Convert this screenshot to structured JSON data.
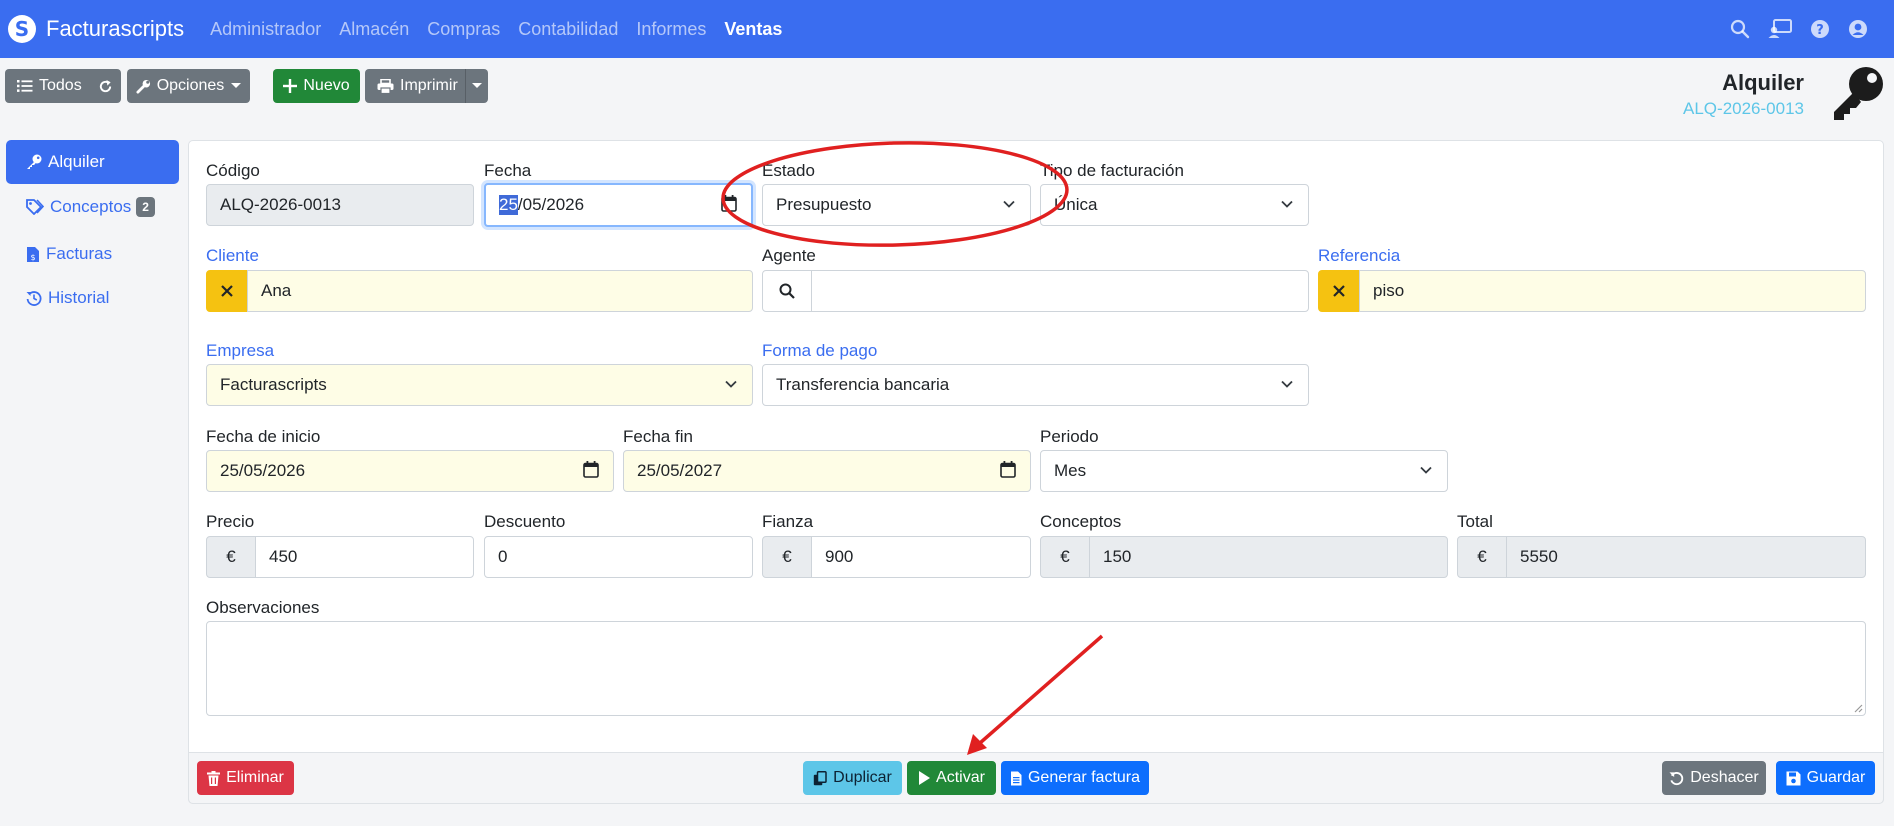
{
  "navbar": {
    "brand": "Facturascripts",
    "brand_glyph": "S",
    "menu": [
      "Administrador",
      "Almacén",
      "Compras",
      "Contabilidad",
      "Informes",
      "Ventas"
    ],
    "active_menu": "Ventas",
    "icons": [
      "search-icon",
      "notifications-icon",
      "help-icon",
      "user-icon"
    ]
  },
  "toolbar": {
    "all_label": "Todos",
    "options_label": "Opciones",
    "new_label": "Nuevo",
    "print_label": "Imprimir"
  },
  "header": {
    "title": "Alquiler",
    "code": "ALQ-2026-0013",
    "icon": "key-icon"
  },
  "sidebar": {
    "items": [
      {
        "label": "Alquiler",
        "icon": "key-icon",
        "active": true
      },
      {
        "label": "Conceptos",
        "icon": "tags-icon",
        "badge": "2"
      },
      {
        "label": "Facturas",
        "icon": "invoice-icon"
      },
      {
        "label": "Historial",
        "icon": "history-icon"
      }
    ]
  },
  "form": {
    "codigo_label": "Código",
    "codigo_value": "ALQ-2026-0013",
    "fecha_label": "Fecha",
    "fecha_day": "25",
    "fecha_rest": "/05/2026",
    "estado_label": "Estado",
    "estado_value": "Presupuesto",
    "tipo_label": "Tipo de facturación",
    "tipo_value": "Única",
    "cliente_label": "Cliente",
    "cliente_value": "Ana",
    "agente_label": "Agente",
    "agente_value": "",
    "referencia_label": "Referencia",
    "referencia_value": "piso",
    "empresa_label": "Empresa",
    "empresa_value": "Facturascripts",
    "formapago_label": "Forma de pago",
    "formapago_value": "Transferencia bancaria",
    "inicio_label": "Fecha de inicio",
    "inicio_value": "25/05/2026",
    "fin_label": "Fecha fin",
    "fin_value": "25/05/2027",
    "periodo_label": "Periodo",
    "periodo_value": "Mes",
    "precio_label": "Precio",
    "precio_value": "450",
    "descuento_label": "Descuento",
    "descuento_value": "0",
    "fianza_label": "Fianza",
    "fianza_value": "900",
    "conceptos_label": "Conceptos",
    "conceptos_value": "150",
    "total_label": "Total",
    "total_value": "5550",
    "currency": "€",
    "observaciones_label": "Observaciones",
    "observaciones_value": ""
  },
  "footer": {
    "delete_label": "Eliminar",
    "duplicate_label": "Duplicar",
    "activate_label": "Activar",
    "invoice_label": "Generar factura",
    "undo_label": "Deshacer",
    "save_label": "Guardar"
  },
  "colors": {
    "primary": "#3a6df0",
    "success": "#218838",
    "danger": "#dc3545",
    "info": "#5dc6e8",
    "warning": "#f5c211",
    "annotation": "#e02020"
  }
}
